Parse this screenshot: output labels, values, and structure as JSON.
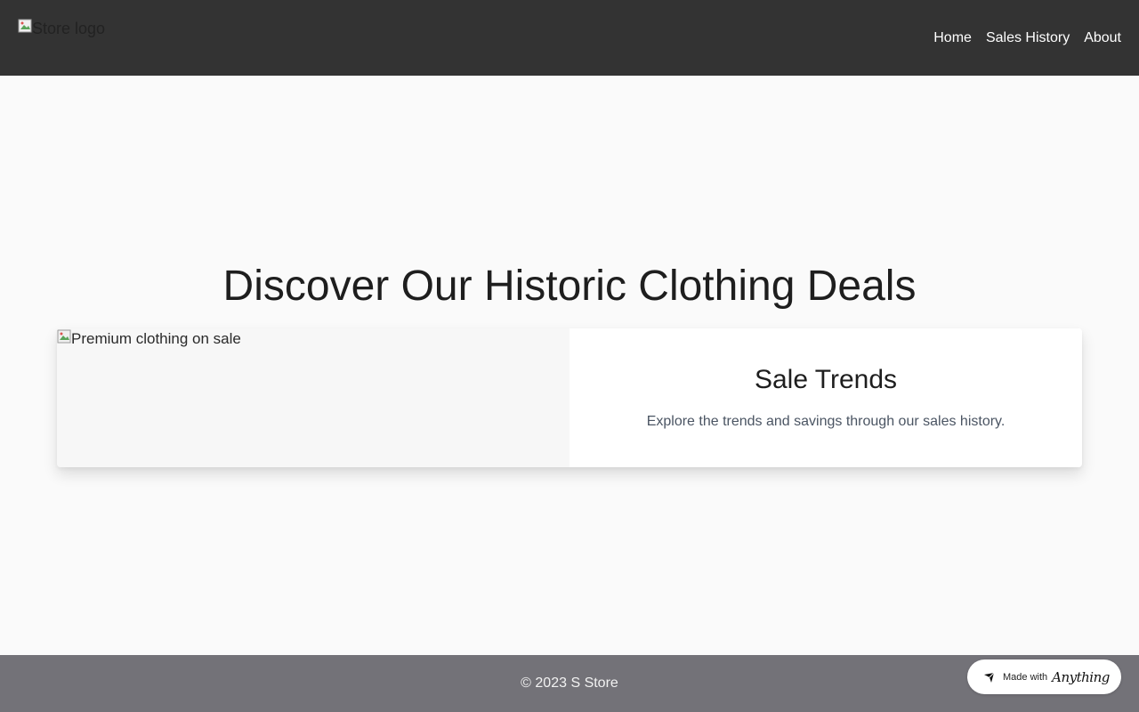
{
  "header": {
    "logo_alt": "Store logo",
    "nav": {
      "home": "Home",
      "sales_history": "Sales History",
      "about": "About"
    }
  },
  "main": {
    "title": "Discover Our Historic Clothing Deals",
    "card": {
      "image_alt": "Premium clothing on sale",
      "title": "Sale Trends",
      "text": "Explore the trends and savings through our sales history."
    }
  },
  "footer": {
    "copyright": "© 2023 S Store"
  },
  "badge": {
    "prefix": "Made with",
    "brand": "Anything",
    "icon": "anything-logo-icon"
  }
}
